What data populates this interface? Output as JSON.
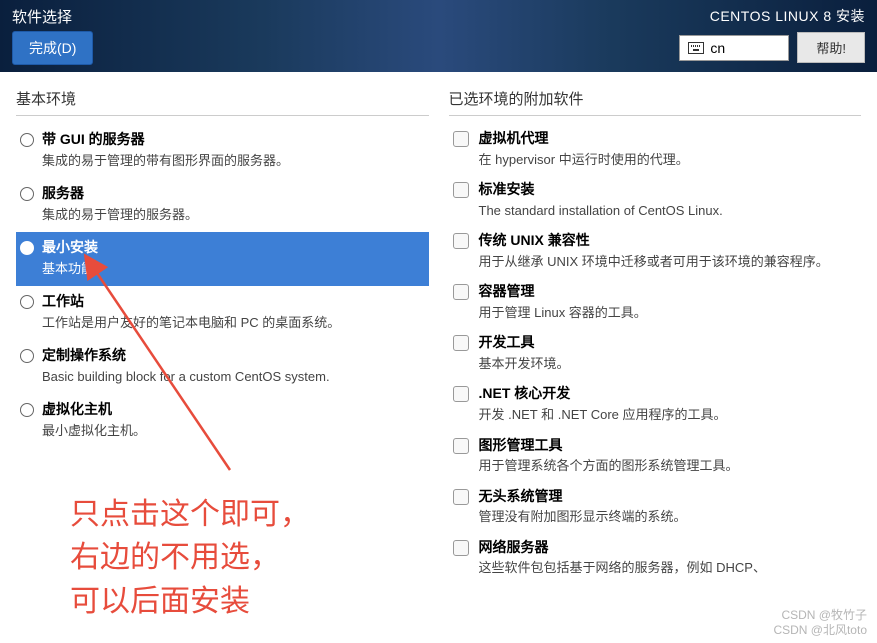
{
  "header": {
    "page_title": "软件选择",
    "done_label": "完成(D)",
    "install_title": "CENTOS LINUX 8 安装",
    "lang_code": "cn",
    "help_label": "帮助!"
  },
  "left": {
    "title": "基本环境",
    "items": [
      {
        "title": "带 GUI 的服务器",
        "desc": "集成的易于管理的带有图形界面的服务器。",
        "selected": false
      },
      {
        "title": "服务器",
        "desc": "集成的易于管理的服务器。",
        "selected": false
      },
      {
        "title": "最小安装",
        "desc": "基本功能。",
        "selected": true
      },
      {
        "title": "工作站",
        "desc": "工作站是用户友好的笔记本电脑和 PC 的桌面系统。",
        "selected": false
      },
      {
        "title": "定制操作系统",
        "desc": "Basic building block for a custom CentOS system.",
        "selected": false
      },
      {
        "title": "虚拟化主机",
        "desc": "最小虚拟化主机。",
        "selected": false
      }
    ]
  },
  "right": {
    "title": "已选环境的附加软件",
    "items": [
      {
        "title": "虚拟机代理",
        "desc": "在 hypervisor 中运行时使用的代理。"
      },
      {
        "title": "标准安装",
        "desc": "The standard installation of CentOS Linux."
      },
      {
        "title": "传统 UNIX 兼容性",
        "desc": "用于从继承 UNIX 环境中迁移或者可用于该环境的兼容程序。"
      },
      {
        "title": "容器管理",
        "desc": "用于管理 Linux 容器的工具。"
      },
      {
        "title": "开发工具",
        "desc": "基本开发环境。"
      },
      {
        "title": ".NET 核心开发",
        "desc": "开发 .NET 和 .NET Core 应用程序的工具。"
      },
      {
        "title": "图形管理工具",
        "desc": "用于管理系统各个方面的图形系统管理工具。"
      },
      {
        "title": "无头系统管理",
        "desc": "管理没有附加图形显示终端的系统。"
      },
      {
        "title": "网络服务器",
        "desc": "这些软件包包括基于网络的服务器，例如 DHCP、"
      }
    ]
  },
  "annotation": {
    "line1": "只点击这个即可，",
    "line2": "右边的不用选，",
    "line3": "可以后面安装"
  },
  "watermark": {
    "line1": "CSDN @牧竹子",
    "line2": "CSDN @北风toto"
  }
}
